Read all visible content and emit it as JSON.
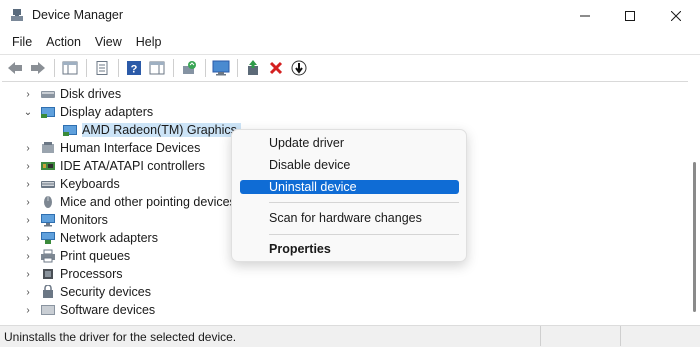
{
  "window": {
    "title": "Device Manager",
    "controls": {
      "minimize": "—",
      "maximize": "☐",
      "close": "✕"
    }
  },
  "menubar": {
    "items": [
      "File",
      "Action",
      "View",
      "Help"
    ]
  },
  "toolbar": {
    "buttons": [
      "back-icon",
      "forward-icon",
      "show-hide-console-tree-icon",
      "properties-icon",
      "help-icon",
      "show-action-pane-icon",
      "update-driver-icon",
      "monitor-icon",
      "add-legacy-hardware-icon",
      "uninstall-icon",
      "disable-icon"
    ]
  },
  "tree": {
    "rows": [
      {
        "label": "Disk drives",
        "expanded": false,
        "level": 0
      },
      {
        "label": "Display adapters",
        "expanded": true,
        "level": 0
      },
      {
        "label": "AMD Radeon(TM) Graphics",
        "level": 1,
        "selected": true
      },
      {
        "label": "Human Interface Devices",
        "expanded": false,
        "level": 0
      },
      {
        "label": "IDE ATA/ATAPI controllers",
        "expanded": false,
        "level": 0
      },
      {
        "label": "Keyboards",
        "expanded": false,
        "level": 0
      },
      {
        "label": "Mice and other pointing devices",
        "expanded": false,
        "level": 0
      },
      {
        "label": "Monitors",
        "expanded": false,
        "level": 0
      },
      {
        "label": "Network adapters",
        "expanded": false,
        "level": 0
      },
      {
        "label": "Print queues",
        "expanded": false,
        "level": 0
      },
      {
        "label": "Processors",
        "expanded": false,
        "level": 0
      },
      {
        "label": "Security devices",
        "expanded": false,
        "level": 0
      },
      {
        "label": "Software devices",
        "expanded": false,
        "level": 0
      }
    ]
  },
  "context_menu": {
    "items": [
      {
        "label": "Update driver"
      },
      {
        "label": "Disable device"
      },
      {
        "label": "Uninstall device",
        "highlighted": true
      },
      {
        "label": "Scan for hardware changes"
      },
      {
        "label": "Properties",
        "bold": true
      }
    ]
  },
  "statusbar": {
    "text": "Uninstalls the driver for the selected device."
  },
  "colors": {
    "accent": "#0f6cd5",
    "selection": "#cce4f7"
  }
}
